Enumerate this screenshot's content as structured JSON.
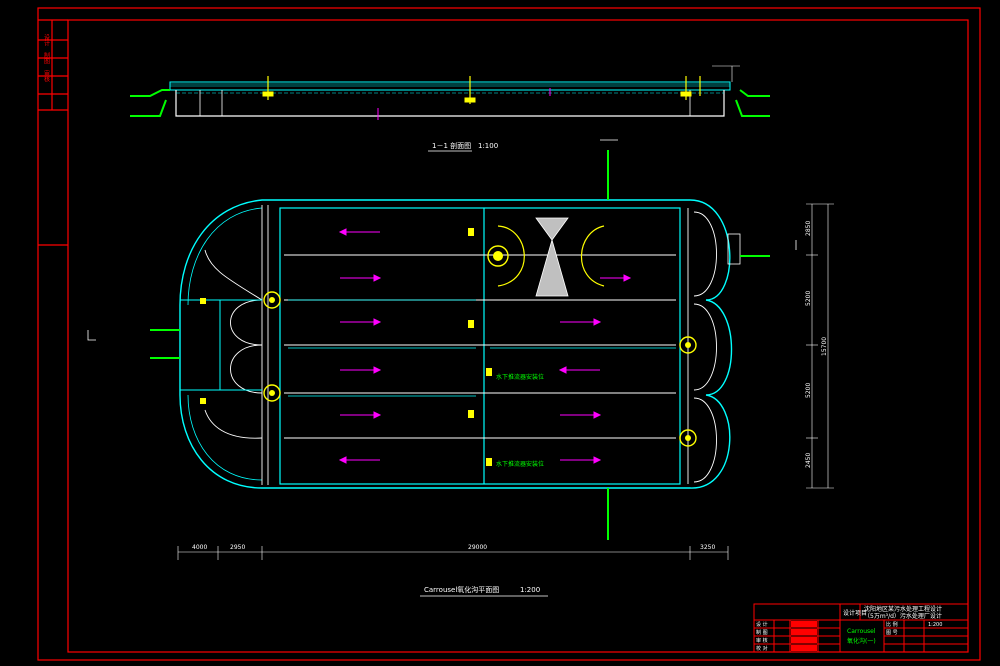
{
  "colors": {
    "background": "#000000",
    "frame": "#ff0000",
    "tank": "#00ffff",
    "walls": "#ffffff",
    "flow_arrows": "#ff00ff",
    "equipment": "#ffff00",
    "aerator_green": "#00ff00",
    "dims": "#ffffff",
    "annot_green": "#00ff00"
  },
  "section": {
    "title": "1－1 剖面图",
    "scale": "1:100"
  },
  "plan": {
    "title": "Carrousel氧化沟平面图",
    "scale": "1:200",
    "labels": {
      "aerator_note_1": "水下推流器安装位",
      "aerator_note_2": "水下推流器安装位"
    },
    "dims_bottom": [
      "4000",
      "2950",
      "29000",
      "3250"
    ],
    "dims_right": [
      "2850",
      "5200",
      "5200",
      "2450"
    ],
    "dim_right_total": "15700"
  },
  "title_block": {
    "design_item_label": "设计项目",
    "project_line1": "沈阳地区某污水处理工程设计",
    "project_line2": "（5万m³/d）污水处理厂设计",
    "drawing_name": "Carrousel",
    "drawing_name2": "氧化沟(一)",
    "scale_value": "1:200",
    "rows_left": [
      "设 计",
      "制 图",
      "审 核",
      "校 对"
    ],
    "scale_label": "比 例",
    "drawing_no_label": "图 号"
  },
  "side_strip": {
    "labels": [
      "设计",
      "制图",
      "审核"
    ]
  }
}
